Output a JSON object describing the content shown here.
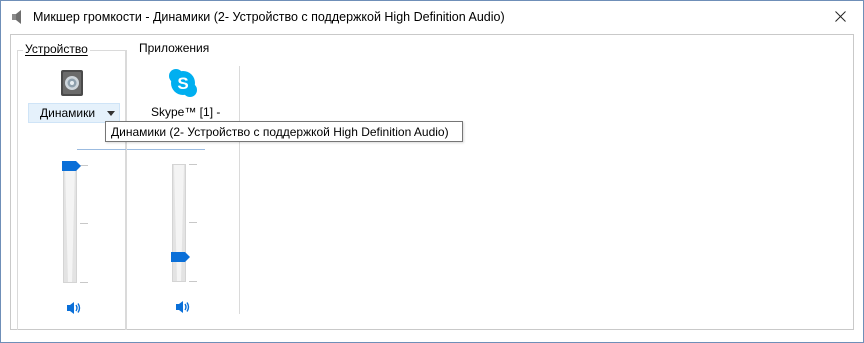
{
  "window": {
    "title": "Микшер громкости - Динамики (2- Устройство с поддержкой High Definition Audio)",
    "title_icon": "speaker-icon",
    "close_icon": "close-icon"
  },
  "device": {
    "group_label": "Устройство",
    "icon": "speaker-device-icon",
    "dropdown_label": "Динамики",
    "volume_level": 1.0,
    "mute_icon": "speaker-volume-icon"
  },
  "apps": {
    "group_label": "Приложения",
    "items": [
      {
        "name": "Skype™ [1] -",
        "icon": "skype-icon",
        "volume_level": 0.15,
        "mute_icon": "speaker-volume-icon"
      }
    ]
  },
  "tooltip": {
    "text": "Динамики (2- Устройство с поддержкой High Definition Audio)"
  },
  "colors": {
    "accent": "#0a6fd8",
    "skype": "#00aff0",
    "border": "#c9c9c9"
  }
}
